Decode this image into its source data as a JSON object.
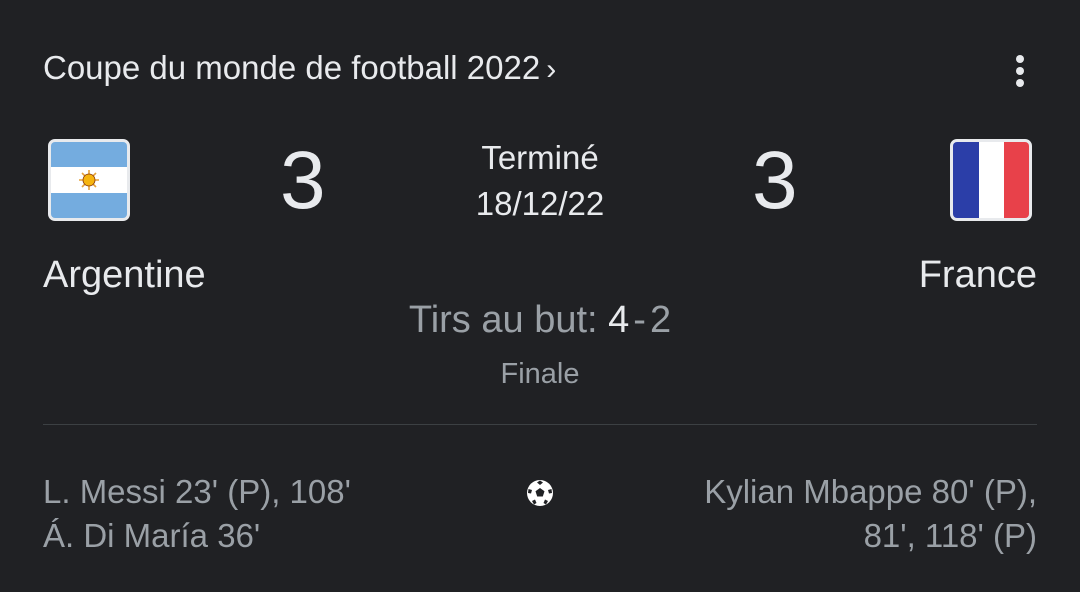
{
  "header": {
    "title": "Coupe du monde de football 2022",
    "chevron": "›",
    "menu_icon": "more-vert-icon"
  },
  "match": {
    "status": "Terminé",
    "date": "18/12/22",
    "stage": "Finale",
    "penalties": {
      "label": "Tirs au but:",
      "home": "4",
      "separator": "-",
      "away": "2"
    }
  },
  "home_team": {
    "name": "Argentine",
    "score": "3",
    "flag": "argentina-flag-icon",
    "scorers": [
      "L. Messi 23' (P), 108'",
      "Á. Di María 36'"
    ]
  },
  "away_team": {
    "name": "France",
    "score": "3",
    "flag": "france-flag-icon",
    "scorers": [
      "Kylian Mbappe 80' (P),",
      "81', 118' (P)"
    ]
  },
  "goals_icon": "soccer-ball-icon",
  "colors": {
    "background": "#202124",
    "primary_text": "#e8eaed",
    "secondary_text": "#9aa0a6",
    "divider": "#3c4043"
  }
}
